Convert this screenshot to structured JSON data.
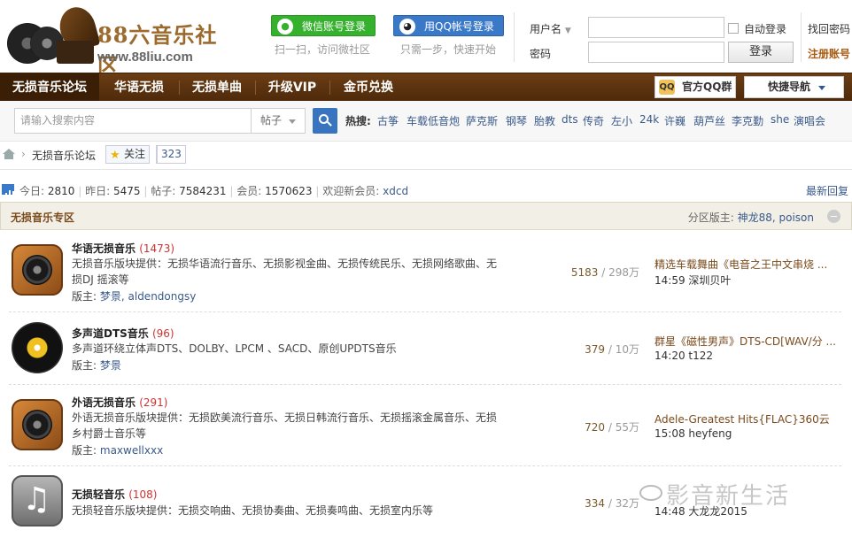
{
  "header": {
    "logo_title": "88六音乐社区",
    "logo_url": "www.88liu.com",
    "wechat_btn": "微信账号登录",
    "wechat_hint": "扫一扫，访问微社区",
    "qq_btn": "用QQ帐号登录",
    "qq_hint": "只需一步，快速开始",
    "username_label": "用户名",
    "password_label": "密码",
    "auto_login": "自动登录",
    "login_btn": "登录",
    "forgot_pwd": "找回密码",
    "register": "注册账号"
  },
  "nav": {
    "items": [
      "无损音乐论坛",
      "华语无损",
      "无损单曲",
      "升级VIP",
      "金币兑换"
    ],
    "qq_group": "官方QQ群",
    "quick_nav": "快捷导航"
  },
  "search": {
    "placeholder": "请输入搜索内容",
    "type": "帖子",
    "hot_label": "热搜:",
    "hot_words": [
      "古筝",
      "车载低音炮",
      "萨克斯",
      "钢琴",
      "胎教",
      "dts",
      "传奇",
      "左小",
      "24k",
      "许巍",
      "葫芦丝",
      "李克勤",
      "she",
      "演唱会"
    ]
  },
  "breadcrumb": {
    "current": "无损音乐论坛",
    "follow": "关注",
    "follow_count": "323"
  },
  "stats": {
    "today_label": "今日:",
    "today": "2810",
    "yesterday_label": "昨日:",
    "yesterday": "5475",
    "posts_label": "帖子:",
    "posts": "7584231",
    "members_label": "会员:",
    "members": "1570623",
    "welcome_label": "欢迎新会员:",
    "new_member": "xdcd",
    "latest_reply": "最新回复"
  },
  "section": {
    "title": "无损音乐专区",
    "mods_label": "分区版主:",
    "mods": "神龙88, poison"
  },
  "forums": [
    {
      "name": "华语无损音乐",
      "count": "(1473)",
      "desc": "无损音乐版块提供：无损华语流行音乐、无损影视金曲、无损传统民乐、无损网络歌曲、无损DJ 摇滚等",
      "mod_label": "版主:",
      "mods": "梦景, aldendongsy",
      "topics": "5183",
      "posts": "298万",
      "last_title": "精选车载舞曲《电音之王中文串烧 ...",
      "last_time": "14:59 深圳贝叶",
      "icon": "speaker-icon"
    },
    {
      "name": "多声道DTS音乐",
      "count": "(96)",
      "desc": "多声道环绕立体声DTS、DOLBY、LPCM 、SACD、原创UPDTS音乐",
      "mod_label": "版主:",
      "mods": "梦景",
      "topics": "379",
      "posts": "10万",
      "last_title": "群星《磁性男声》DTS-CD[WAV/分 ...",
      "last_time": "14:20 t122",
      "icon": "vinyl-icon"
    },
    {
      "name": "外语无损音乐",
      "count": "(291)",
      "desc": "外语无损音乐版块提供：无损欧美流行音乐、无损日韩流行音乐、无损摇滚金属音乐、无损乡村爵士音乐等",
      "mod_label": "版主:",
      "mods": "maxwellxxx",
      "topics": "720",
      "posts": "55万",
      "last_title": "Adele-Greatest Hits{FLAC}360云",
      "last_time": "15:08 heyfeng",
      "icon": "speaker-icon"
    },
    {
      "name": "无损轻音乐",
      "count": "(108)",
      "desc": "无损轻音乐版块提供：无损交响曲、无损协奏曲、无损奏鸣曲、无损室内乐等",
      "mod_label": "",
      "mods": "",
      "topics": "334",
      "posts": "32万",
      "last_title": "",
      "last_time": "14:48 大龙龙2015",
      "icon": "music-note-icon"
    }
  ],
  "watermark": "影音新生活"
}
